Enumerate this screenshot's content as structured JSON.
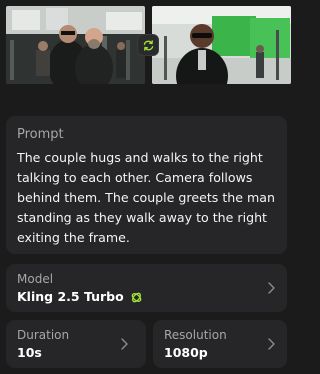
{
  "images": {
    "left": {
      "name": "source-image-couple"
    },
    "right": {
      "name": "target-image-man"
    },
    "swap": {
      "icon": "swap-arrows-icon"
    }
  },
  "prompt": {
    "label": "Prompt",
    "text": "The couple hugs and walks to the right talking to each other. Camera follows behind them. The couple greets the man standing as they walk away to the right exiting the frame."
  },
  "model": {
    "label": "Model",
    "value": "Kling 2.5 Turbo",
    "icon": "model-badge-icon",
    "accent": "#a3e635"
  },
  "duration": {
    "label": "Duration",
    "value": "10s"
  },
  "resolution": {
    "label": "Resolution",
    "value": "1080p"
  },
  "colors": {
    "background": "#1b1b1c",
    "card": "#262628",
    "label": "#a6a6aa",
    "text": "#f4f4f5",
    "accent": "#a3e635"
  }
}
